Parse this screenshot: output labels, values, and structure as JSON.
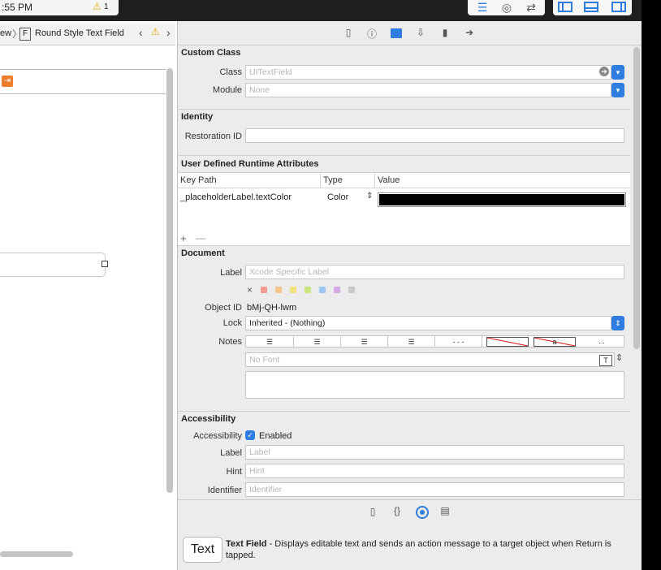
{
  "toolbar": {
    "time": ":55 PM",
    "warning_count": "1"
  },
  "jumpbar": {
    "crumb_prev": "ew",
    "crumb_current": "Round Style Text Field",
    "file_badge": "F"
  },
  "inspector": {
    "custom_class": {
      "title": "Custom Class",
      "class_label": "Class",
      "class_placeholder": "UITextField",
      "module_label": "Module",
      "module_placeholder": "None"
    },
    "identity": {
      "title": "Identity",
      "restoration_label": "Restoration ID"
    },
    "runtime": {
      "title": "User Defined Runtime Attributes",
      "headers": [
        "Key Path",
        "Type",
        "Value"
      ],
      "rows": [
        {
          "key_path": "_placeholderLabel.textColor",
          "type": "Color",
          "value_color": "#000000"
        }
      ],
      "add": "+",
      "remove": "—"
    },
    "document": {
      "title": "Document",
      "label_label": "Label",
      "label_placeholder": "Xcode Specific Label",
      "label_swatches": [
        "#f29a94",
        "#f6c58a",
        "#f4e27c",
        "#c9e67f",
        "#9cc7f2",
        "#d6a8e6",
        "#c8c8c8"
      ],
      "clear_icon": "×",
      "object_id_label": "Object ID",
      "object_id": "bMj-QH-lwm",
      "lock_label": "Lock",
      "lock_value": "Inherited - (Nothing)",
      "notes_label": "Notes",
      "font_placeholder": "No Font",
      "notes_more": "...",
      "notes_a": "a"
    },
    "accessibility": {
      "title": "Accessibility",
      "acc_label": "Accessibility",
      "enabled_label": "Enabled",
      "label_label": "Label",
      "label_placeholder": "Label",
      "hint_label": "Hint",
      "hint_placeholder": "Hint",
      "identifier_label": "Identifier",
      "identifier_placeholder": "Identifier"
    },
    "library": {
      "thumb_label": "Text",
      "title": "Text Field",
      "description": " - Displays editable text and sends an action message to a target object when Return is tapped."
    }
  }
}
